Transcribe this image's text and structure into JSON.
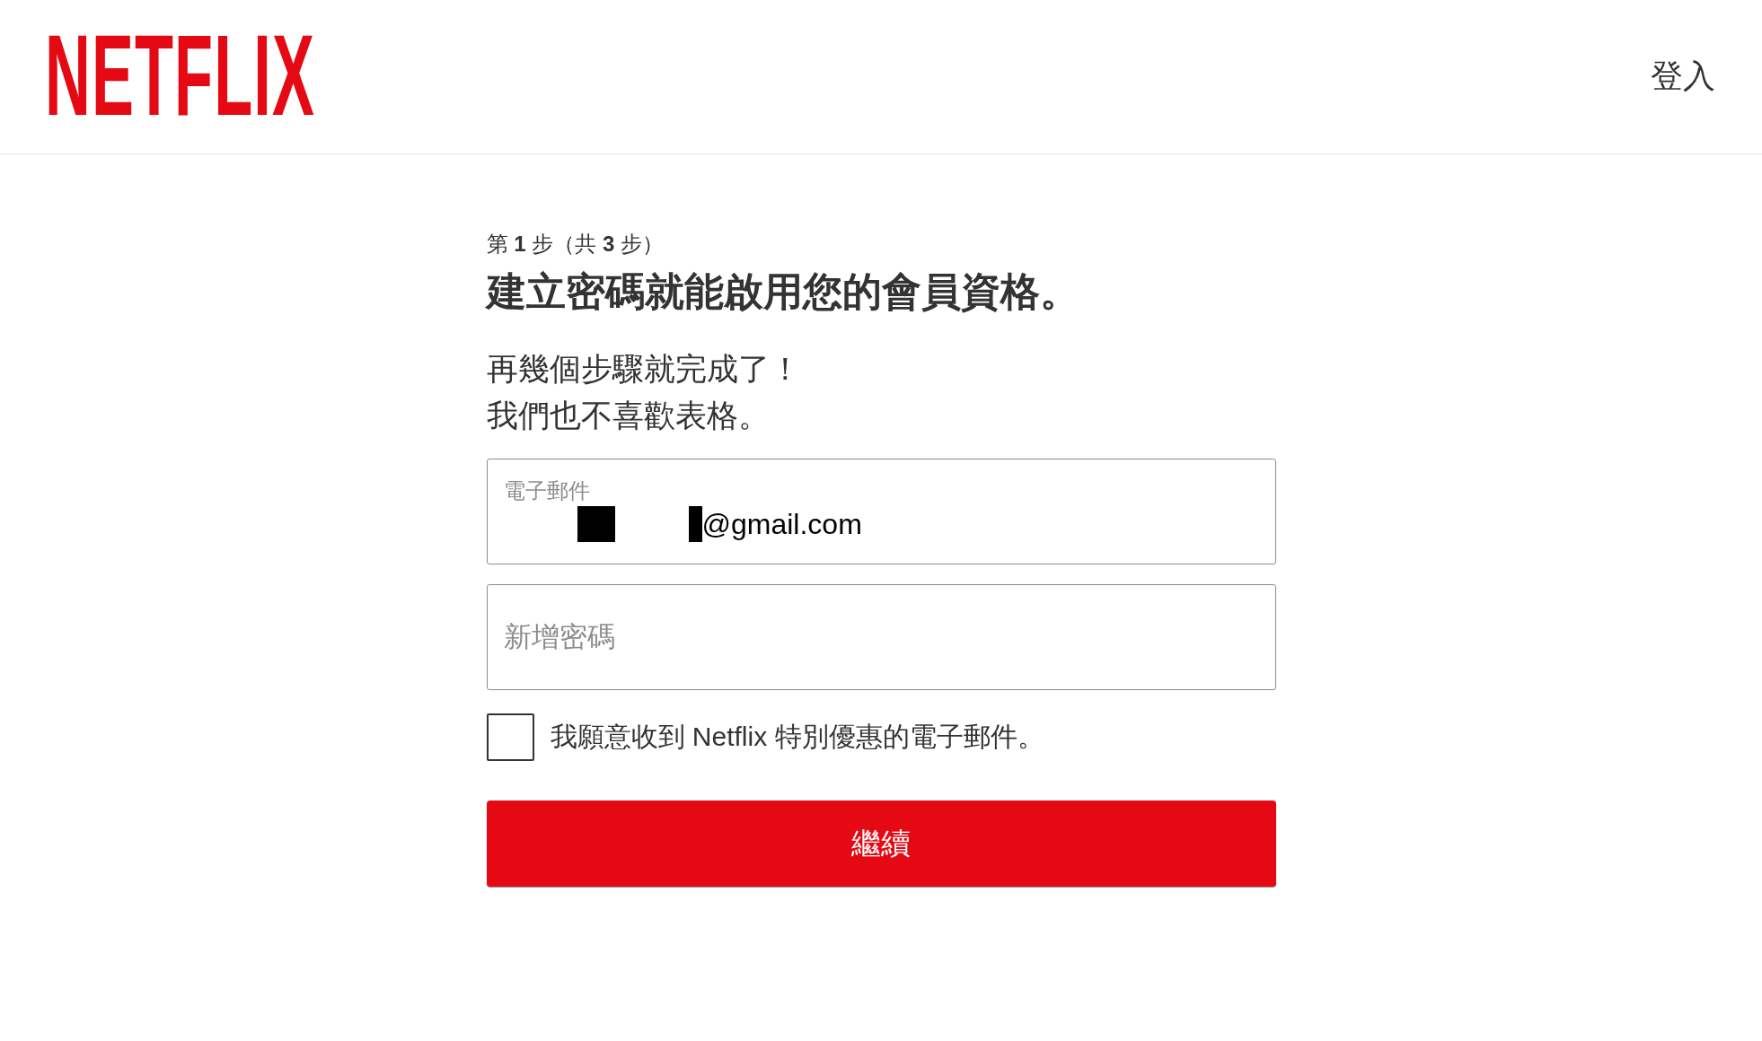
{
  "header": {
    "logo": "NETFLIX",
    "sign_in": "登入"
  },
  "step": "第 **1** 步（共 **3** 步）",
  "title": "建立密碼就能啟用您的會員資格。",
  "intro": [
    "再幾個步驟就完成了！",
    "我們也不喜歡表格。"
  ],
  "email_field": {
    "label": "電子郵件",
    "value": "@gmail.com"
  },
  "password_field": {
    "placeholder": "新增密碼"
  },
  "offers_checkbox": {
    "label": "我願意收到 Netflix 特別優惠的電子郵件。",
    "checked": false
  },
  "continue_button": "繼續"
}
